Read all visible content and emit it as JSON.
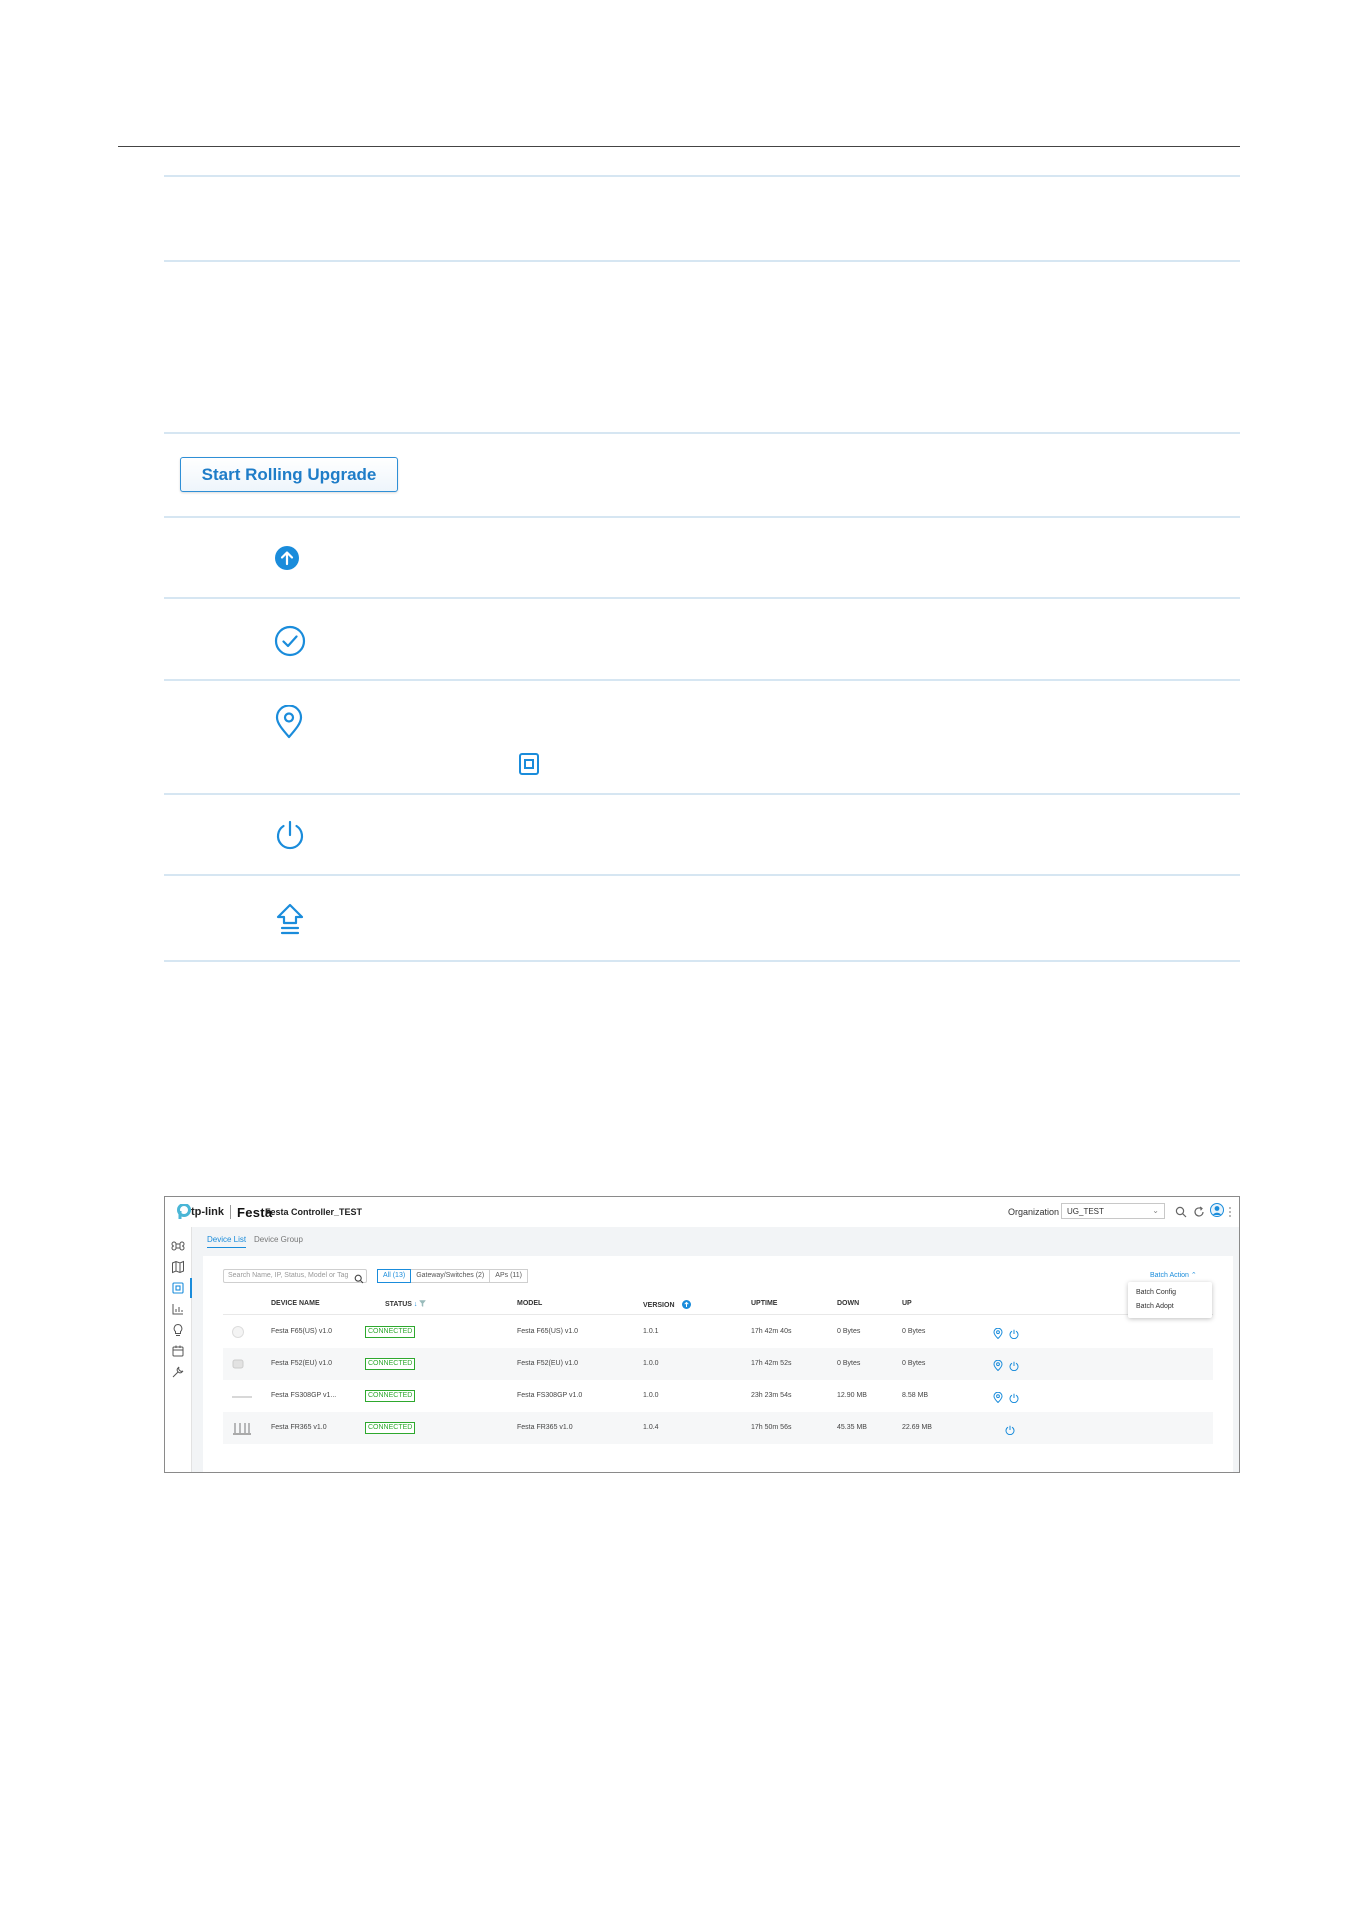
{
  "doc": {
    "rolling_upgrade_button": "Start Rolling Upgrade"
  },
  "icons": {
    "upgrade": "arrow-up-circle-filled-icon",
    "adopt": "check-circle-icon",
    "locate": "location-pin-icon",
    "locate_inline": "square-icon",
    "reboot": "power-icon",
    "force_provision": "house-upload-icon"
  },
  "screenshot": {
    "brand": "tp-link",
    "product": "Festa",
    "controller_name": "Festa Controller_TEST",
    "organization_label": "Organization",
    "organization_value": "UG_TEST",
    "tabs": [
      {
        "label": "Device List",
        "active": true
      },
      {
        "label": "Device Group",
        "active": false
      }
    ],
    "search_placeholder": "Search Name, IP, Status, Model or Tag",
    "filters": [
      {
        "label": "All (13)",
        "active": true
      },
      {
        "label": "Gateway/Switches (2)",
        "active": false
      },
      {
        "label": "APs (11)",
        "active": false
      }
    ],
    "batch_action": "Batch Action",
    "batch_menu": [
      "Batch Config",
      "Batch Adopt"
    ],
    "columns": {
      "device_name": "DEVICE NAME",
      "status": "STATUS",
      "model": "MODEL",
      "version": "VERSION",
      "uptime": "UPTIME",
      "down": "DOWN",
      "up": "UP"
    },
    "rows": [
      {
        "name": "Festa F65(US) v1.0",
        "status": "CONNECTED",
        "model": "Festa F65(US) v1.0",
        "version": "1.0.1",
        "uptime": "17h 42m 40s",
        "down": "0 Bytes",
        "up": "0 Bytes"
      },
      {
        "name": "Festa F52(EU) v1.0",
        "status": "CONNECTED",
        "model": "Festa F52(EU) v1.0",
        "version": "1.0.0",
        "uptime": "17h 42m 52s",
        "down": "0 Bytes",
        "up": "0 Bytes"
      },
      {
        "name": "Festa FS308GP v1...",
        "status": "CONNECTED",
        "model": "Festa FS308GP v1.0",
        "version": "1.0.0",
        "uptime": "23h 23m 54s",
        "down": "12.90 MB",
        "up": "8.58 MB"
      },
      {
        "name": "Festa FR365 v1.0",
        "status": "CONNECTED",
        "model": "Festa FR365 v1.0",
        "version": "1.0.4",
        "uptime": "17h 50m 56s",
        "down": "45.35 MB",
        "up": "22.69 MB"
      }
    ],
    "colors": {
      "accent": "#1a8cdb",
      "connected": "#2ea82e"
    }
  }
}
